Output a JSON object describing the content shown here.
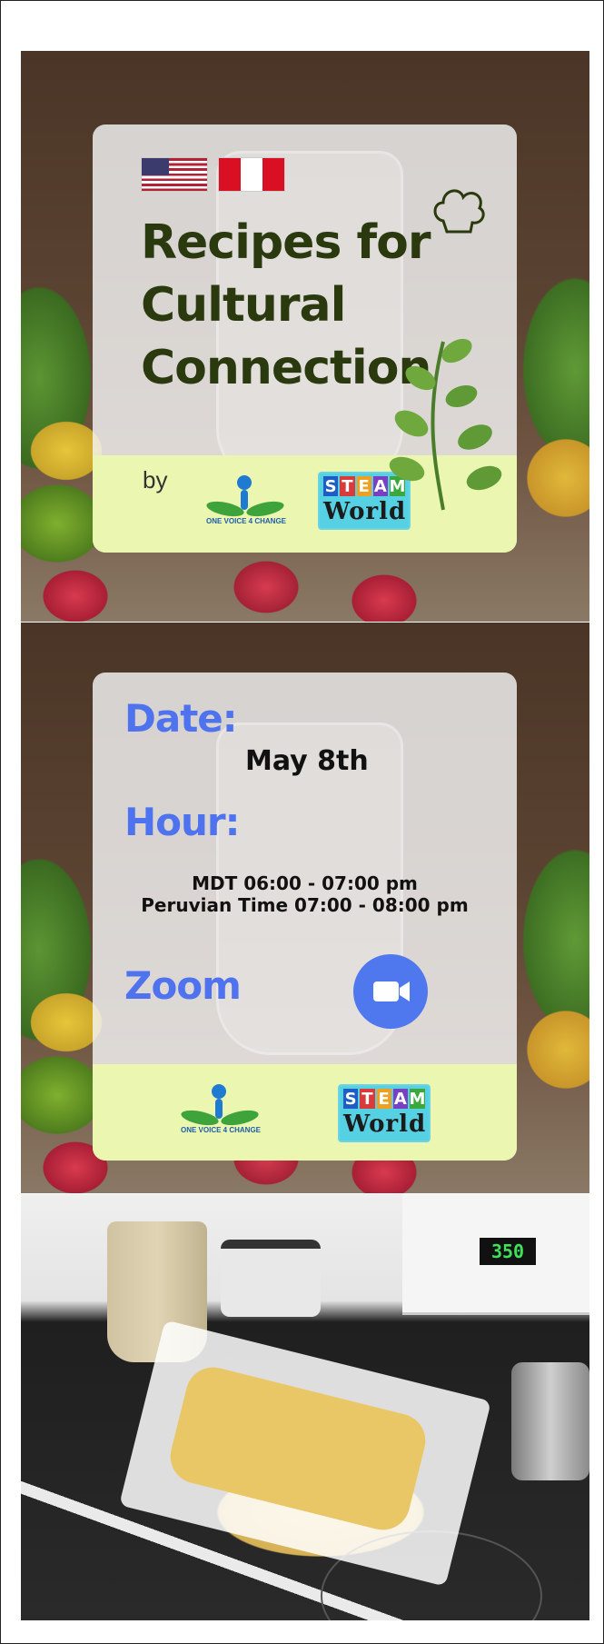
{
  "flyer": {
    "title": "Recipes for Cultural Connection",
    "by_label": "by",
    "flags": [
      "us-flag-icon",
      "peru-flag-icon"
    ]
  },
  "logos": {
    "one_voice": "ONE VOICE 4 CHANGE",
    "steam_letters": [
      "S",
      "T",
      "E",
      "A",
      "M"
    ],
    "steam_world": "World"
  },
  "event": {
    "date_label": "Date:",
    "date_value": "May 8th",
    "hour_label": "Hour:",
    "hour_line1": "MDT 06:00 - 07:00 pm",
    "hour_line2": "Peruvian Time 07:00 - 08:00 pm",
    "zoom_label": "Zoom",
    "zoom_icon": "video-camera-icon"
  },
  "photo": {
    "oven_display": "350"
  },
  "colors": {
    "title": "#2a3a0e",
    "label_blue": "#4f73ee",
    "footer_green": "#ebf7b0"
  }
}
